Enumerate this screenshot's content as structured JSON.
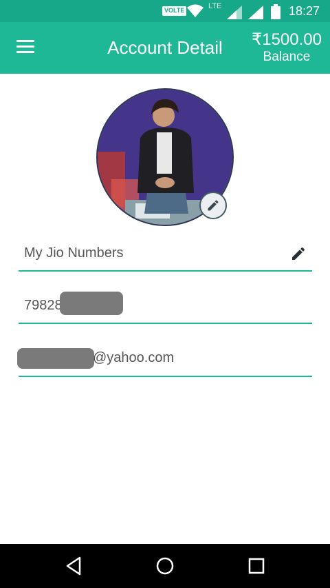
{
  "status_bar": {
    "volte": "VOLTE",
    "network": "LTE",
    "time": "18:27",
    "icons": [
      "volte-icon",
      "wifi-icon",
      "signal-icon",
      "signal-icon",
      "battery-icon"
    ]
  },
  "app_bar": {
    "menu_icon": "menu-icon",
    "title": "Account Detail",
    "balance_amount": "₹1500.00",
    "balance_label": "Balance"
  },
  "profile": {
    "photo": "profile-photo",
    "edit_icon": "pencil-icon"
  },
  "fields": {
    "jio_numbers_label": "My Jio Numbers",
    "phone_visible": "79828",
    "email_visible": "@yahoo.com"
  },
  "nav_bar": {
    "icons": [
      "back-icon",
      "home-icon",
      "recents-icon"
    ]
  },
  "colors": {
    "status_bar": "#17a889",
    "app_bar": "#1fb897",
    "accent_underline": "#1fb897",
    "nav_bar": "#000000"
  }
}
